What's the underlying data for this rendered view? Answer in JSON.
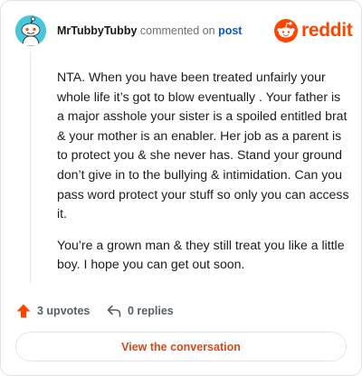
{
  "header": {
    "username": "MrTubbyTubby",
    "action_text": "commented on",
    "post_link": "post",
    "brand": "reddit"
  },
  "comment": {
    "paragraphs": [
      "NTA. When you have been treated unfairly your whole life it’s got to blow eventually . Your father is a major asshole your sister is a spoiled entitled brat & your mother is an enabler. Her job as a parent is to protect you & she never has. Stand your ground don’t give in to the bullying & intimidation. Can you pass word protect your stuff so only you can access it.",
      "You’re a grown man & they still treat you like a little boy. I hope you can get out soon."
    ]
  },
  "actions": {
    "upvotes": "3 upvotes",
    "replies": "0 replies"
  },
  "cta": {
    "label": "View the conversation"
  },
  "colors": {
    "brand": "#ff4500",
    "link": "#0a5bbd",
    "avatar_bg": "#47c6dc",
    "upvote_icon": "#ff4500",
    "cta_text": "#d94a1b"
  },
  "icons": {
    "avatar": "snoo-avatar-icon",
    "brand": "reddit-logo-icon",
    "upvote": "upvote-arrow-icon",
    "reply": "reply-arrow-icon"
  }
}
